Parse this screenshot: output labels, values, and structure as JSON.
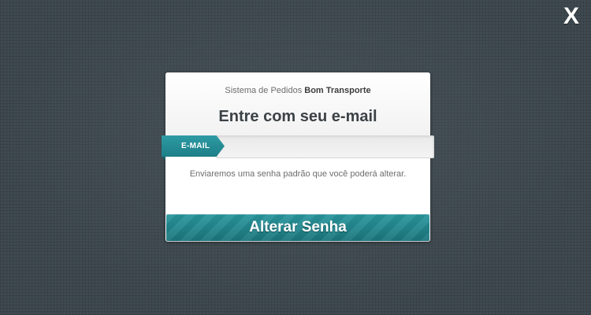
{
  "close": {
    "label": "X",
    "icon": "close-icon"
  },
  "login": {
    "subtitle_prefix": "Sistema de Pedidos",
    "subtitle_brand": "Bom Transporte",
    "title": "Entre com seu e-mail",
    "email_label": "E-MAIL",
    "email_value": "",
    "email_placeholder": "",
    "helper_text": "Enviaremos uma senha padrão que você poderá alterar.",
    "submit_label": "Alterar Senha"
  },
  "colors": {
    "background": "#3f4a50",
    "accent": "#1f7f86",
    "card": "#ffffff"
  }
}
